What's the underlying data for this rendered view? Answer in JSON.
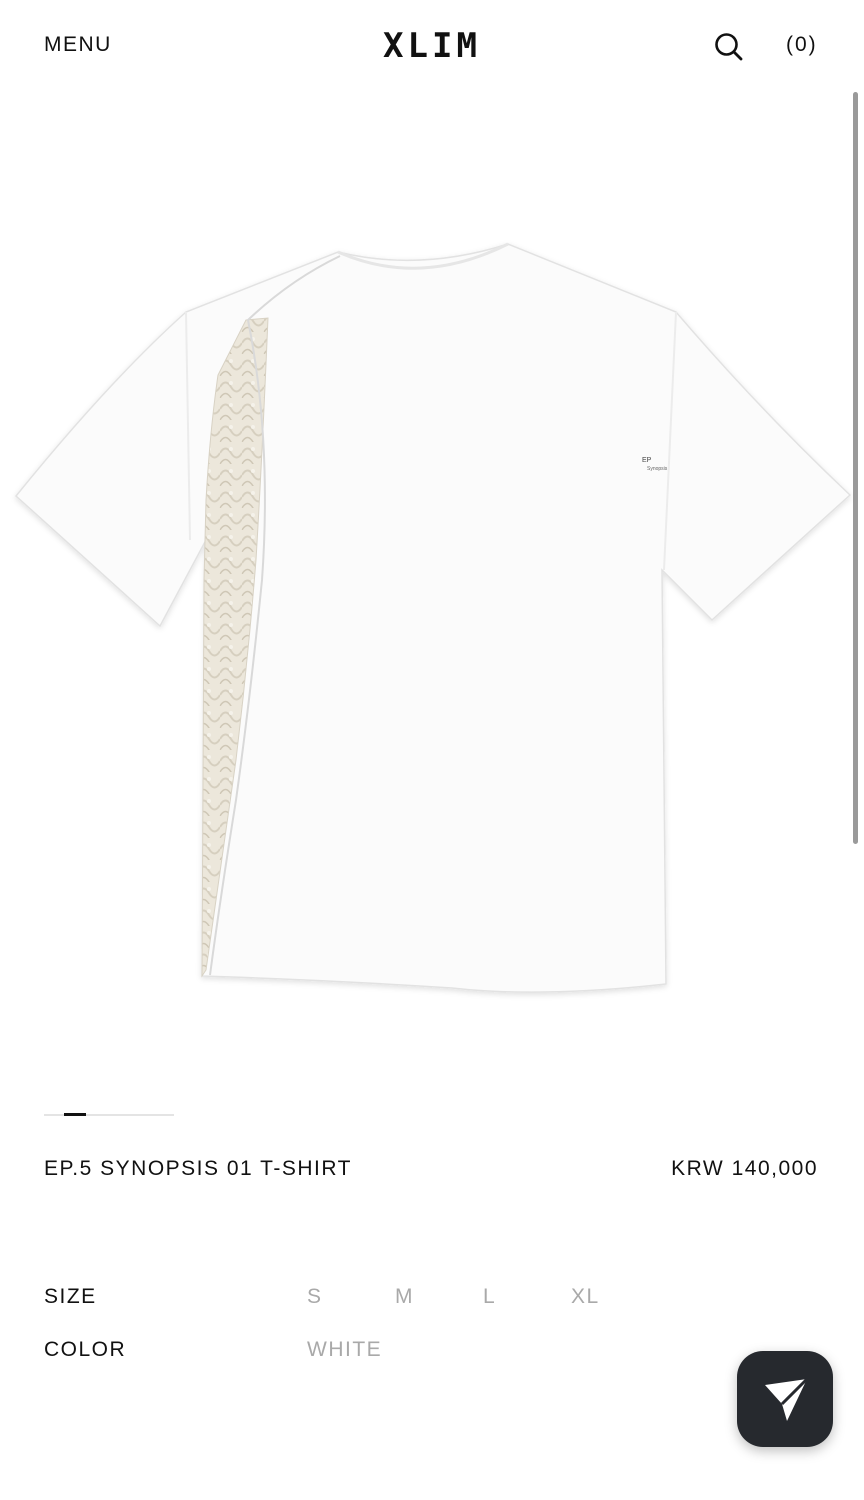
{
  "header": {
    "menu_label": "MENU",
    "logo_text": "XLIM",
    "search_icon": "search-icon",
    "cart_label": "(0)"
  },
  "product": {
    "image_icon": "t-shirt-image",
    "carousel": {
      "active_index": 1
    },
    "name": "EP.5 SYNOPSIS 01 T-SHIRT",
    "price": "KRW 140,000",
    "size_label": "SIZE",
    "sizes": [
      "S",
      "M",
      "L",
      "XL"
    ],
    "color_label": "COLOR",
    "colors": [
      "WHITE"
    ]
  },
  "fab": {
    "icon": "send-icon"
  },
  "colors": {
    "text": "#111111",
    "muted": "#a9a9a9",
    "fab_bg": "#26292e"
  }
}
